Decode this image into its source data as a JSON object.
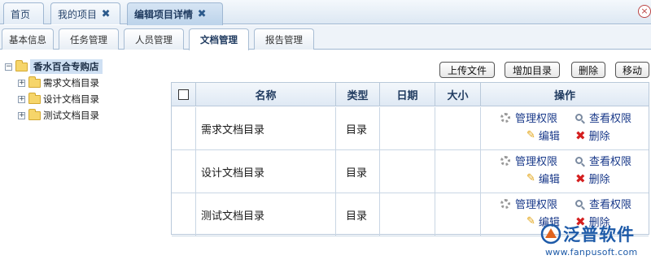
{
  "top_tabs": [
    {
      "label": "首页",
      "closable": false
    },
    {
      "label": "我的项目",
      "closable": true
    },
    {
      "label": "编辑项目详情",
      "closable": true,
      "active": true
    }
  ],
  "window_close": "×",
  "sub_tabs": [
    {
      "label": "基本信息"
    },
    {
      "label": "任务管理"
    },
    {
      "label": "人员管理"
    },
    {
      "label": "文档管理",
      "active": true
    },
    {
      "label": "报告管理"
    }
  ],
  "tree": {
    "root": "香水百合专购店",
    "children": [
      "需求文档目录",
      "设计文档目录",
      "测试文档目录"
    ]
  },
  "actions": {
    "upload": "上传文件",
    "add_dir": "增加目录",
    "delete": "删除",
    "move": "移动"
  },
  "table": {
    "columns": [
      "名称",
      "类型",
      "日期",
      "大小",
      "操作"
    ],
    "rows": [
      {
        "name": "需求文档目录",
        "type": "目录",
        "date": "",
        "size": ""
      },
      {
        "name": "设计文档目录",
        "type": "目录",
        "date": "",
        "size": ""
      },
      {
        "name": "测试文档目录",
        "type": "目录",
        "date": "",
        "size": ""
      }
    ],
    "row_ops": {
      "manage": "管理权限",
      "view": "查看权限",
      "edit": "编辑",
      "remove": "删除"
    }
  },
  "watermark": {
    "name": "泛普软件",
    "url": "www.fanpusoft.com"
  },
  "colors": {
    "accent": "#1f3a5f",
    "link": "#1a3a8a",
    "delete": "#d41f1f",
    "brand": "#1d5aa8"
  }
}
